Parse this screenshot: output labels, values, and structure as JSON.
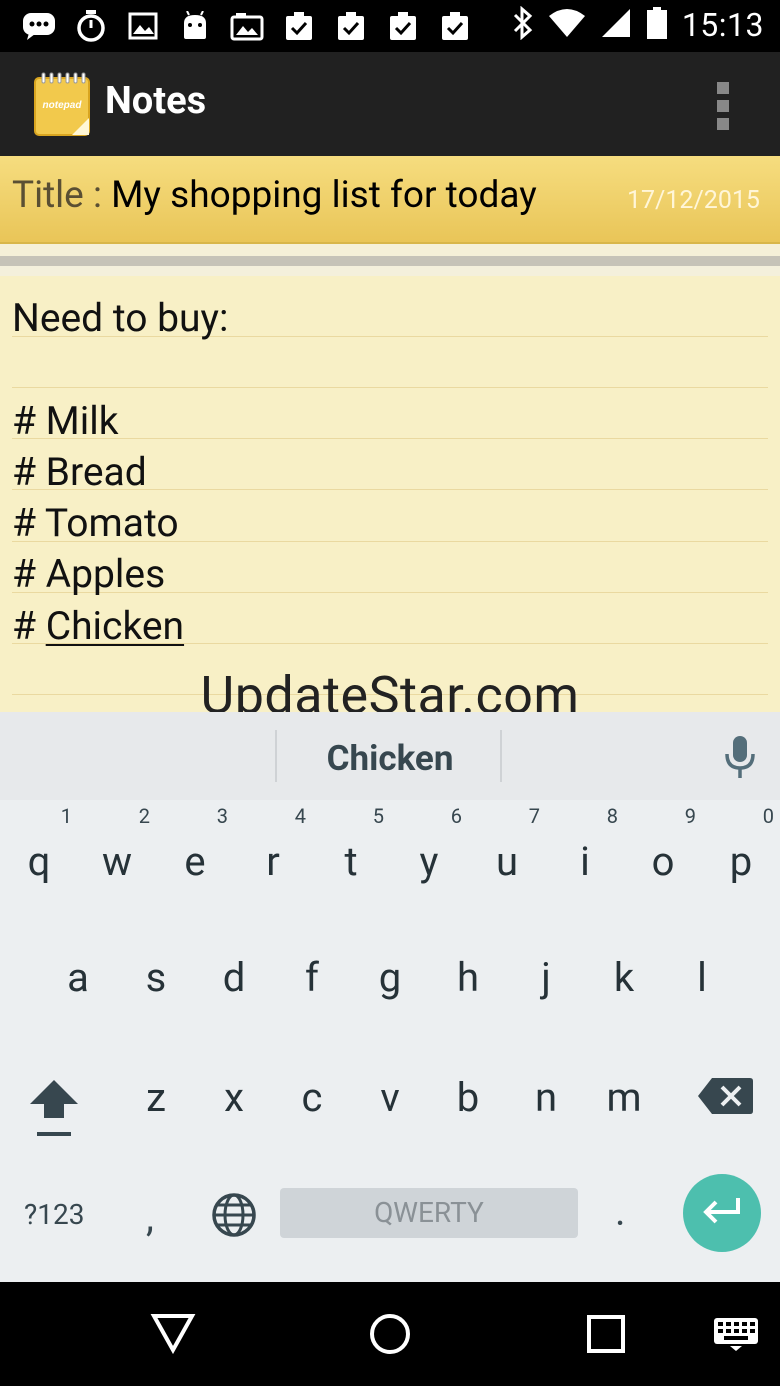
{
  "status_bar": {
    "time": "15:13",
    "icons": [
      "chat-icon",
      "timer-icon",
      "image-icon",
      "android-icon",
      "photo-icon",
      "clipboard-check-icon",
      "clipboard-check-icon",
      "clipboard-check-icon",
      "clipboard-check-icon",
      "bluetooth-icon",
      "wifi-icon",
      "signal-icon",
      "battery-icon"
    ]
  },
  "app_bar": {
    "logo_text": "notepad",
    "title": "Notes"
  },
  "note_header": {
    "label": "Title : ",
    "title": "My shopping list for today",
    "date": "17/12/2015"
  },
  "note_body": {
    "lines": [
      "Need to buy:",
      "",
      "# Milk",
      "# Bread",
      "# Tomato",
      "# Apples",
      "# ",
      "Chicken"
    ]
  },
  "watermark": "UpdateStar.com",
  "keyboard": {
    "suggestion": "Chicken",
    "row1": [
      {
        "key": "q",
        "hint": "1"
      },
      {
        "key": "w",
        "hint": "2"
      },
      {
        "key": "e",
        "hint": "3"
      },
      {
        "key": "r",
        "hint": "4"
      },
      {
        "key": "t",
        "hint": "5"
      },
      {
        "key": "y",
        "hint": "6"
      },
      {
        "key": "u",
        "hint": "7"
      },
      {
        "key": "i",
        "hint": "8"
      },
      {
        "key": "o",
        "hint": "9"
      },
      {
        "key": "p",
        "hint": "0"
      }
    ],
    "row2": [
      "a",
      "s",
      "d",
      "f",
      "g",
      "h",
      "j",
      "k",
      "l"
    ],
    "row3": [
      "z",
      "x",
      "c",
      "v",
      "b",
      "n",
      "m"
    ],
    "symbols_label": "?123",
    "comma_label": ",",
    "space_label": "QWERTY",
    "period_label": ".",
    "accent_color": "#4dbfae"
  }
}
